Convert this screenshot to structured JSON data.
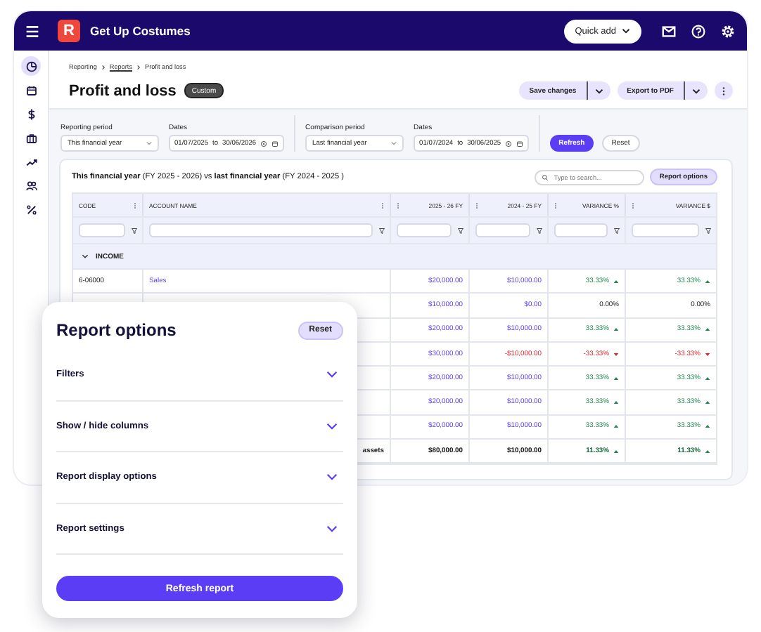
{
  "app_bar": {
    "logo": "R",
    "title": "Get Up Costumes",
    "quick_add": "Quick add"
  },
  "sidebar": {
    "items": [
      {
        "kind": "chart",
        "selected": true
      },
      {
        "kind": "calendar",
        "selected": false
      },
      {
        "kind": "dollar",
        "selected": false
      },
      {
        "kind": "briefcase",
        "selected": false
      },
      {
        "kind": "trend",
        "selected": false
      },
      {
        "kind": "people",
        "selected": false
      },
      {
        "kind": "percent",
        "selected": false
      }
    ]
  },
  "breadcrumb": [
    {
      "label": "Reporting",
      "link": false
    },
    {
      "label": "Reports",
      "link": true
    },
    {
      "label": "Profit and loss",
      "link": false
    }
  ],
  "page": {
    "title": "Profit and loss",
    "badge": "Custom",
    "save_button": "Save changes",
    "export_button": "Export to PDF"
  },
  "periods": [
    {
      "label": "Reporting period",
      "value": "This financial year",
      "dates_label": "Dates",
      "from": "01/07/2025",
      "to_word": "to",
      "to": "30/06/2026"
    },
    {
      "label": "Comparison period",
      "value": "Last financial year",
      "dates_label": "Dates",
      "from": "01/07/2024",
      "to_word": "to",
      "to": "30/06/2025"
    }
  ],
  "refresh_button": "Refresh",
  "reset_button": "Reset",
  "report": {
    "heading": "**This financial year** (FY 2025 - 2026) vs **last financial year** (FY 2024 - 2025 )",
    "search": {
      "placeholder": "Type to search..."
    },
    "options_button": "Report options",
    "columns": [
      "CODE",
      "ACCOUNT NAME",
      "2025 - 26 FY",
      "2024 - 25 FY",
      "VARIANCE %",
      "VARIANCE $"
    ],
    "group": {
      "label": "INCOME",
      "expanded": true
    },
    "rows": [
      {
        "kind": "line",
        "code": "6-06000",
        "name": "Sales",
        "current": "$20,000.00",
        "previous": "$10,000.00",
        "previous_negative": false,
        "variances": [
          {
            "kind": "up",
            "text": "33.33%"
          },
          {
            "kind": "up",
            "text": "33.33%"
          }
        ]
      },
      {
        "kind": "line",
        "current": "$10,000.00",
        "previous": "$0.00",
        "previous_negative": false,
        "variances": [
          {
            "kind": "flat",
            "text": "0.00%"
          },
          {
            "kind": "flat",
            "text": "0.00%"
          }
        ]
      },
      {
        "kind": "line",
        "current": "$20,000.00",
        "previous": "$10,000.00",
        "previous_negative": false,
        "variances": [
          {
            "kind": "up",
            "text": "33.33%"
          },
          {
            "kind": "up",
            "text": "33.33%"
          }
        ]
      },
      {
        "kind": "line",
        "current": "$30,000.00",
        "previous": "-$10,000.00",
        "previous_negative": true,
        "variances": [
          {
            "kind": "down",
            "text": "-33.33%"
          },
          {
            "kind": "down",
            "text": "-33.33%"
          }
        ]
      },
      {
        "kind": "line",
        "current": "$20,000.00",
        "previous": "$10,000.00",
        "previous_negative": false,
        "variances": [
          {
            "kind": "up",
            "text": "33.33%"
          },
          {
            "kind": "up",
            "text": "33.33%"
          }
        ]
      },
      {
        "kind": "line",
        "current": "$20,000.00",
        "previous": "$10,000.00",
        "previous_negative": false,
        "variances": [
          {
            "kind": "up",
            "text": "33.33%"
          },
          {
            "kind": "up",
            "text": "33.33%"
          }
        ]
      },
      {
        "kind": "line",
        "current": "$20,000.00",
        "previous": "$10,000.00",
        "previous_negative": false,
        "variances": [
          {
            "kind": "up",
            "text": "33.33%"
          },
          {
            "kind": "up",
            "text": "33.33%"
          }
        ]
      },
      {
        "kind": "total",
        "name": "assets",
        "current": "$80,000.00",
        "previous": "$10,000.00",
        "previous_negative": false,
        "variances": [
          {
            "kind": "up",
            "text": "11.33%"
          },
          {
            "kind": "up",
            "text": "11.33%"
          }
        ]
      }
    ]
  },
  "options_panel": {
    "title": "Report options",
    "reset": "Reset",
    "sections": [
      {
        "label": "Filters",
        "expanded": false
      },
      {
        "label": "Show / hide columns",
        "expanded": false
      },
      {
        "label": "Report display options",
        "expanded": false
      },
      {
        "label": "Report settings",
        "expanded": false
      }
    ],
    "refresh": "Refresh report"
  }
}
